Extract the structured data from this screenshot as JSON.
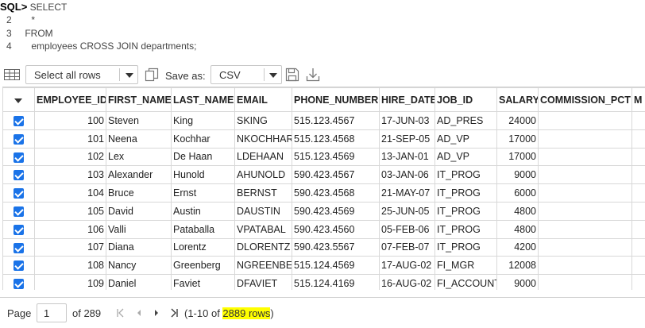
{
  "sql": {
    "prompt": "SQL>",
    "lines": [
      {
        "num": "",
        "code": "SELECT"
      },
      {
        "num": "2",
        "code": "*"
      },
      {
        "num": "3",
        "code": "FROM"
      },
      {
        "num": "4",
        "code": "employees CROSS JOIN departments;"
      }
    ]
  },
  "toolbar": {
    "rows_select": "Select all rows",
    "save_as_label": "Save as:",
    "format_select": "CSV"
  },
  "table": {
    "columns": [
      "EMPLOYEE_ID",
      "FIRST_NAME",
      "LAST_NAME",
      "EMAIL",
      "PHONE_NUMBER",
      "HIRE_DATE",
      "JOB_ID",
      "SALARY",
      "COMMISSION_PCT",
      "M"
    ],
    "rows": [
      [
        "100",
        "Steven",
        "King",
        "SKING",
        "515.123.4567",
        "17-JUN-03",
        "AD_PRES",
        "24000",
        "",
        ""
      ],
      [
        "101",
        "Neena",
        "Kochhar",
        "NKOCHHAR",
        "515.123.4568",
        "21-SEP-05",
        "AD_VP",
        "17000",
        "",
        ""
      ],
      [
        "102",
        "Lex",
        "De Haan",
        "LDEHAAN",
        "515.123.4569",
        "13-JAN-01",
        "AD_VP",
        "17000",
        "",
        ""
      ],
      [
        "103",
        "Alexander",
        "Hunold",
        "AHUNOLD",
        "590.423.4567",
        "03-JAN-06",
        "IT_PROG",
        "9000",
        "",
        ""
      ],
      [
        "104",
        "Bruce",
        "Ernst",
        "BERNST",
        "590.423.4568",
        "21-MAY-07",
        "IT_PROG",
        "6000",
        "",
        ""
      ],
      [
        "105",
        "David",
        "Austin",
        "DAUSTIN",
        "590.423.4569",
        "25-JUN-05",
        "IT_PROG",
        "4800",
        "",
        ""
      ],
      [
        "106",
        "Valli",
        "Pataballa",
        "VPATABAL",
        "590.423.4560",
        "05-FEB-06",
        "IT_PROG",
        "4800",
        "",
        ""
      ],
      [
        "107",
        "Diana",
        "Lorentz",
        "DLORENTZ",
        "590.423.5567",
        "07-FEB-07",
        "IT_PROG",
        "4200",
        "",
        ""
      ],
      [
        "108",
        "Nancy",
        "Greenberg",
        "NGREENBE",
        "515.124.4569",
        "17-AUG-02",
        "FI_MGR",
        "12008",
        "",
        ""
      ],
      [
        "109",
        "Daniel",
        "Faviet",
        "DFAVIET",
        "515.124.4169",
        "16-AUG-02",
        "FI_ACCOUNT",
        "9000",
        "",
        ""
      ]
    ]
  },
  "pagination": {
    "page_label": "Page",
    "page_value": "1",
    "of_label": "of 289",
    "summary_prefix": "(1-10 of ",
    "summary_highlight": "2889 rows",
    "summary_suffix": ")"
  },
  "colors": {
    "checkbox": "#1a73e8",
    "highlight": "#ffff00"
  }
}
